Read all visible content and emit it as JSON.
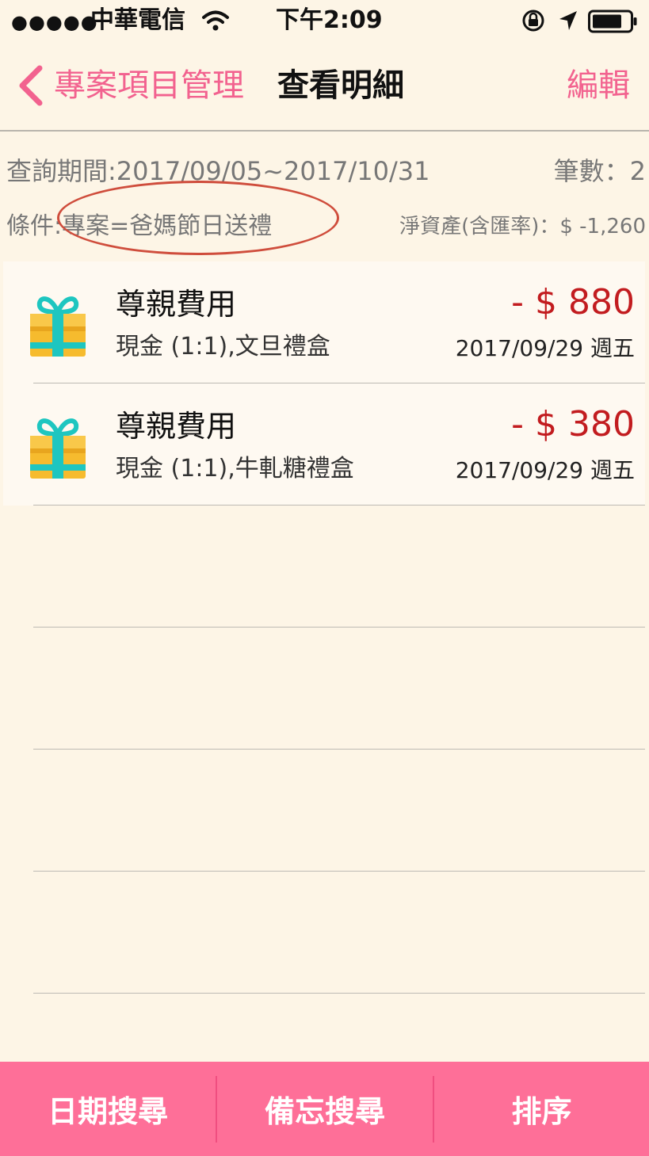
{
  "status_bar": {
    "signal_dots": "●●●●●",
    "carrier": "中華電信",
    "time": "下午2:09"
  },
  "nav": {
    "back_label": "專案項目管理",
    "title": "查看明細",
    "edit_label": "編輯"
  },
  "info": {
    "period": "查詢期間:2017/09/05~2017/10/31",
    "count": "筆數：2",
    "condition": "條件:專案=爸媽節日送禮",
    "net_assets": "淨資產(含匯率)：$ -1,260"
  },
  "records": [
    {
      "title": "尊親費用",
      "subtitle": "現金 (1:1),文旦禮盒",
      "amount": "- $ 880",
      "date": "2017/09/29 週五",
      "icon": "gift-icon"
    },
    {
      "title": "尊親費用",
      "subtitle": "現金 (1:1),牛軋糖禮盒",
      "amount": "- $ 380",
      "date": "2017/09/29 週五",
      "icon": "gift-icon"
    }
  ],
  "tabs": [
    {
      "label": "日期搜尋"
    },
    {
      "label": "備忘搜尋"
    },
    {
      "label": "排序"
    }
  ],
  "colors": {
    "accent": "#f2628f",
    "tab_bar": "#fe6f98",
    "amount": "#c21c1f",
    "background": "#fdf5e6",
    "annotation": "#cf4d3c"
  }
}
